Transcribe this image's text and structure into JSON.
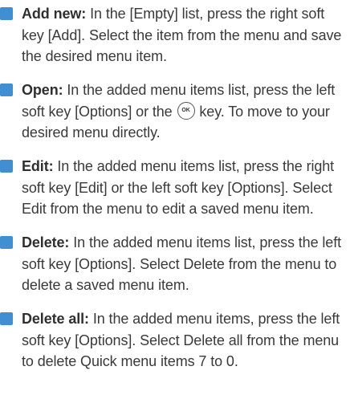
{
  "colors": {
    "bullet": "#3f8fd2",
    "text": "#3a3a3a"
  },
  "items": [
    {
      "term": "Add new:",
      "text": " In the [Empty] list, press the right soft key [Add]. Select the item from the menu and save the desired menu item."
    },
    {
      "term": "Open:",
      "text_before": " In the added menu items list, press the left soft key [Options] or the ",
      "icon": "ok-key-icon",
      "icon_label": "OK",
      "text_after": " key. To move to your desired menu directly."
    },
    {
      "term": "Edit:",
      "text": " In the added menu items list, press the right soft key [Edit] or the left soft key [Options]. Select Edit from the menu to edit a saved menu item."
    },
    {
      "term": "Delete:",
      "text": " In the added menu items list, press the left soft key [Options]. Select Delete from the menu to delete a saved menu item."
    },
    {
      "term": "Delete all:",
      "text": " In the added menu items, press the left soft key [Options]. Select Delete all from the menu to delete Quick menu items 7 to 0."
    }
  ]
}
